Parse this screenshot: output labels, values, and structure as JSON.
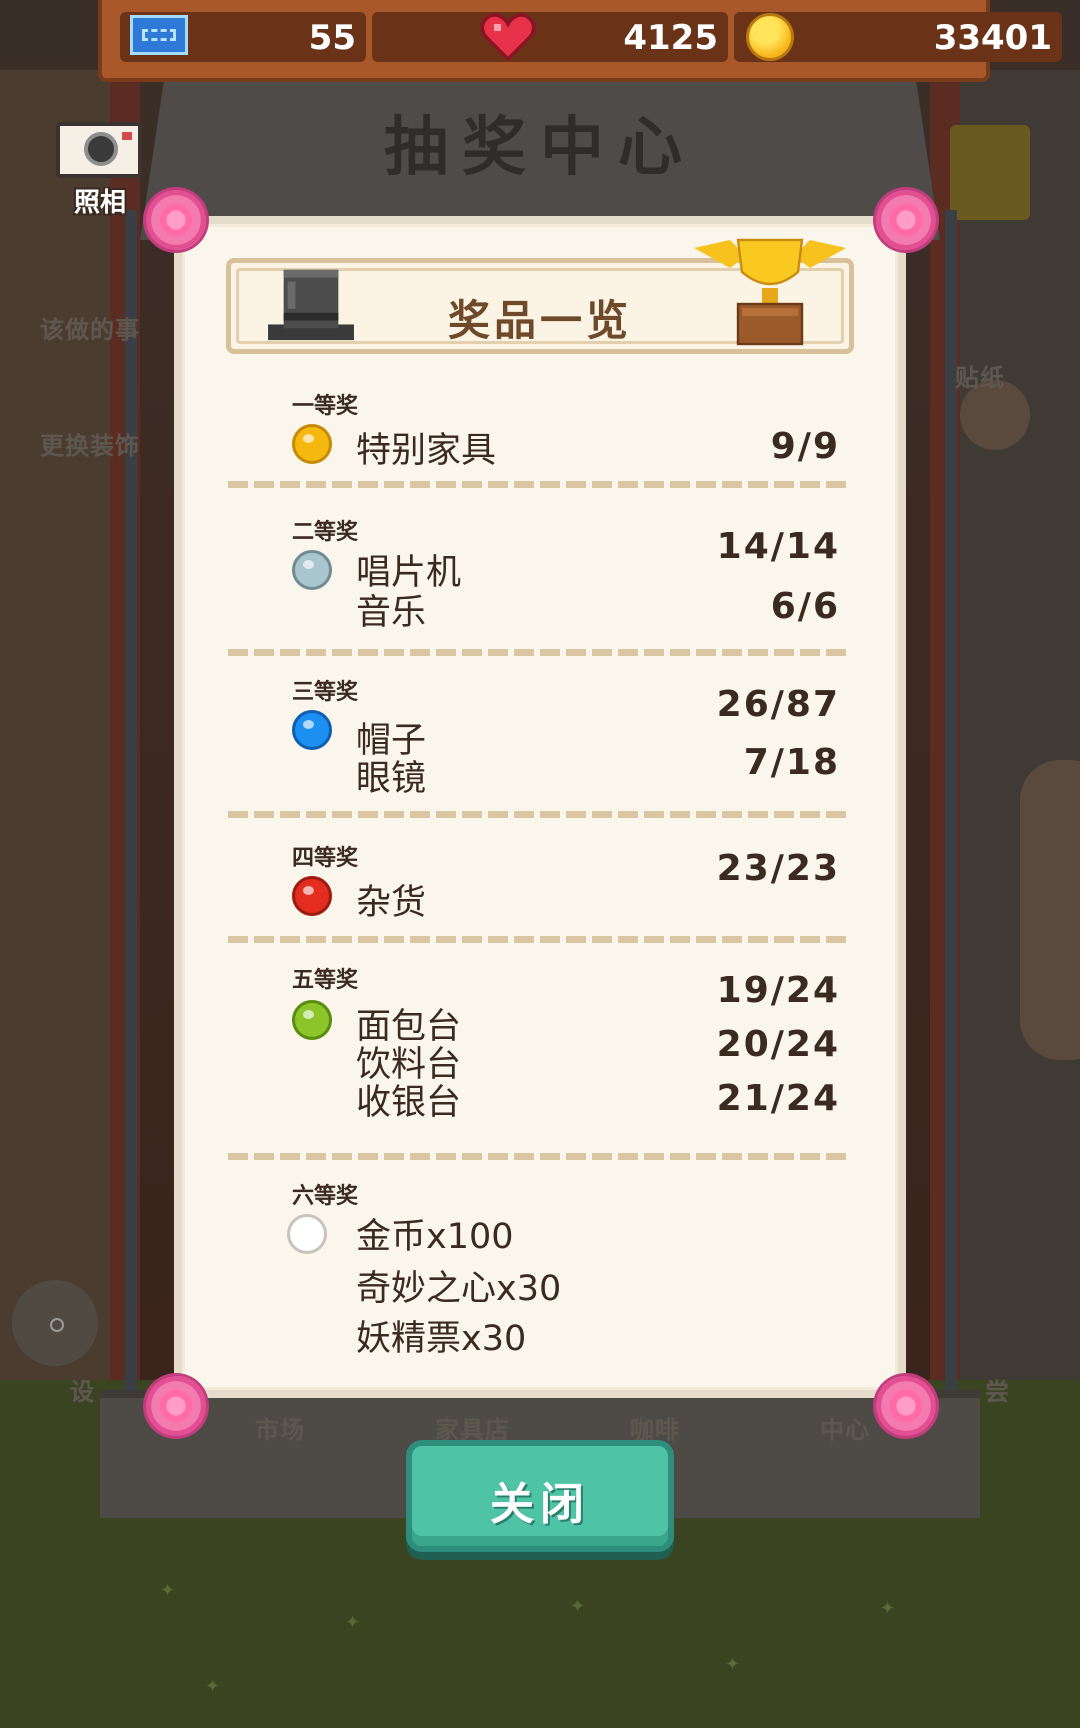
{
  "status_bar": {
    "tickets": "55",
    "hearts": "4125",
    "coins": "33401"
  },
  "background": {
    "title": "抽奖中心",
    "labels": [
      "该做的事",
      "更换装饰",
      "贴纸",
      "市场",
      "家具店",
      "咖啡",
      "中心",
      "设",
      "尝"
    ]
  },
  "camera": {
    "label": "照相"
  },
  "modal": {
    "title": "奖品一览",
    "tiers": [
      {
        "label": "一等奖",
        "gem_color": "#f5b80f",
        "items": [
          {
            "name": "特别家具",
            "count": "9/9"
          }
        ]
      },
      {
        "label": "二等奖",
        "gem_color": "#a9c6cf",
        "items": [
          {
            "name": "唱片机",
            "count": "14/14"
          },
          {
            "name": "音乐",
            "count": "6/6"
          }
        ]
      },
      {
        "label": "三等奖",
        "gem_color": "#1d8ff0",
        "items": [
          {
            "name": "帽子",
            "count": "26/87"
          },
          {
            "name": "眼镜",
            "count": "7/18"
          }
        ]
      },
      {
        "label": "四等奖",
        "gem_color": "#e32d1e",
        "items": [
          {
            "name": "杂货",
            "count": "23/23"
          }
        ]
      },
      {
        "label": "五等奖",
        "gem_color": "#8cc52a",
        "items": [
          {
            "name": "面包台",
            "count": "19/24"
          },
          {
            "name": "饮料台",
            "count": "20/24"
          },
          {
            "name": "收银台",
            "count": "21/24"
          }
        ]
      },
      {
        "label": "六等奖",
        "gem_color": "#ffffff",
        "items": [
          {
            "name": "金币x100"
          },
          {
            "name": "奇妙之心x30"
          },
          {
            "name": "妖精票x30"
          }
        ]
      }
    ],
    "close_label": "关闭"
  },
  "icons": {
    "ticket": "ticket-icon",
    "heart": "heart-icon",
    "coin": "coin-icon",
    "camera": "camera-icon",
    "hat": "top-hat-icon",
    "trophy": "winged-trophy-icon"
  }
}
